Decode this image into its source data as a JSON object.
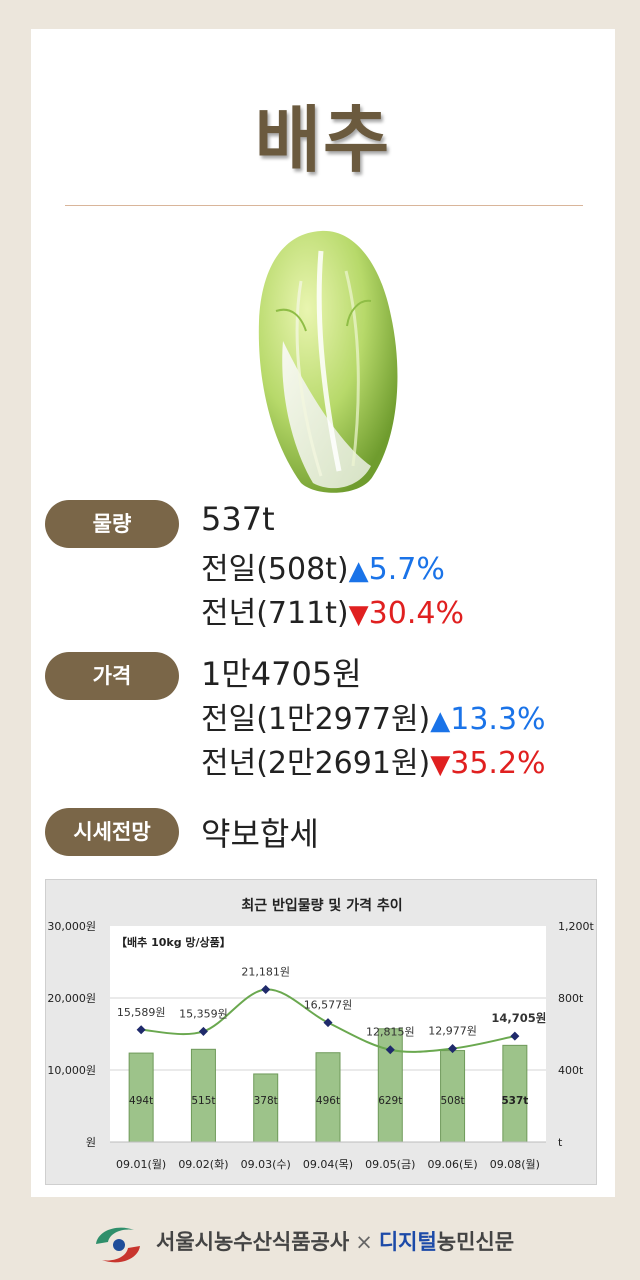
{
  "title": "배추",
  "volume": {
    "label": "물량",
    "value": "537t",
    "prev_day_label": "전일(508t)",
    "prev_day_change": "5.7%",
    "prev_year_label": "전년(711t)",
    "prev_year_change": "30.4%"
  },
  "price": {
    "label": "가격",
    "value": "1만4705원",
    "prev_day_label": "전일(1만2977원)",
    "prev_day_change": "13.3%",
    "prev_year_label": "전년(2만2691원)",
    "prev_year_change": "35.2%"
  },
  "outlook": {
    "label": "시세전망",
    "value": "약보합세"
  },
  "chart_data": {
    "type": "bar",
    "title": "최근 반입물량 및 가격 추이",
    "subtitle": "【배추 10kg 망/상품】",
    "categories": [
      "09.01(월)",
      "09.02(화)",
      "09.03(수)",
      "09.04(목)",
      "09.05(금)",
      "09.06(토)",
      "09.08(월)"
    ],
    "series": [
      {
        "type": "bar",
        "axis": "right",
        "values": [
          494,
          515,
          378,
          496,
          629,
          508,
          537
        ],
        "labels": [
          "494t",
          "515t",
          "378t",
          "496t",
          "629t",
          "508t",
          "537t"
        ]
      },
      {
        "type": "line",
        "axis": "left",
        "values": [
          15589,
          15359,
          21181,
          16577,
          12815,
          12977,
          14705
        ],
        "labels": [
          "15,589원",
          "15,359원",
          "21,181원",
          "16,577원",
          "12,815원",
          "12,977원",
          "14,705원"
        ]
      }
    ],
    "left_axis": {
      "ticks": [
        "30,000원",
        "20,000원",
        "10,000원",
        "원"
      ],
      "ylim": [
        0,
        30000
      ]
    },
    "right_axis": {
      "ticks": [
        "1,200t",
        "800t",
        "400t",
        "t"
      ],
      "ylim": [
        0,
        1200
      ]
    },
    "colors": {
      "bar": "#9dc38a",
      "bar_edge": "#6f9a5a",
      "line": "#6aa84f",
      "marker": "#1f2a6b"
    }
  },
  "footer": {
    "org": "서울시농수산식품공사",
    "separator": "×",
    "brand_a": "디지털",
    "brand_b": "농민신문"
  }
}
